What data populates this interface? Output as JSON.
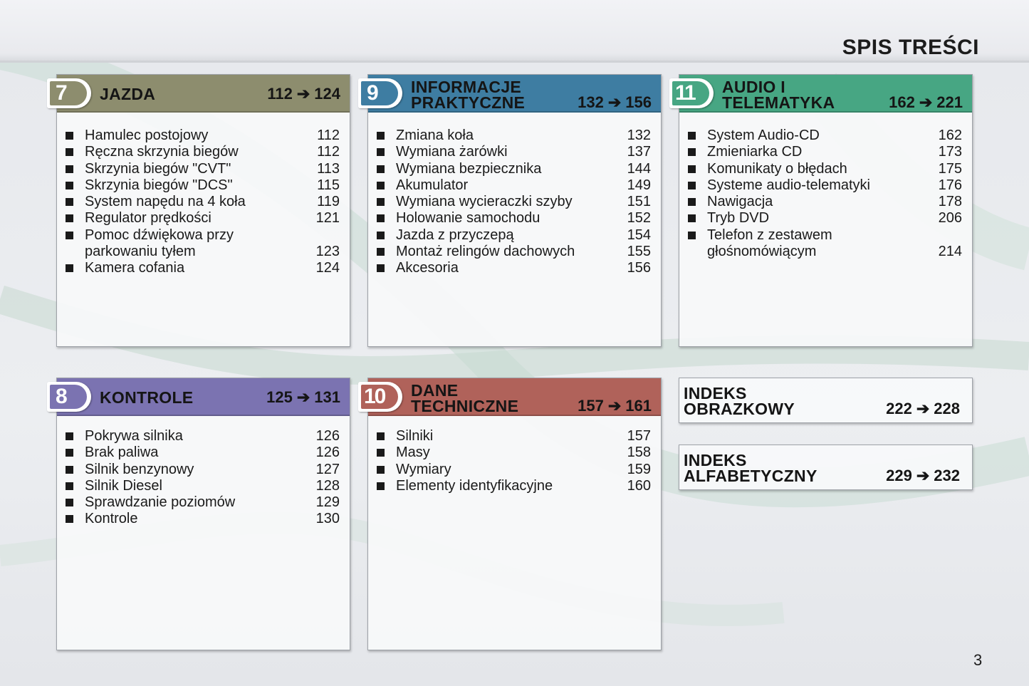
{
  "page": {
    "title": "SPIS TREŚCI",
    "number": "3"
  },
  "sections": {
    "s7": {
      "number": "7",
      "color": "#8d8d6e",
      "title": [
        "JAZDA"
      ],
      "range_from": "112",
      "arrow": "➔",
      "range_to": "124",
      "items": [
        {
          "label": "Hamulec postojowy",
          "page": "112"
        },
        {
          "label": "Ręczna skrzynia biegów",
          "page": "112"
        },
        {
          "label": "Skrzynia biegów \"CVT\"",
          "page": "113"
        },
        {
          "label": "Skrzynia biegów \"DCS\"",
          "page": "115"
        },
        {
          "label": "System napędu na 4 koła",
          "page": "119"
        },
        {
          "label": "Regulator prędkości",
          "page": "121"
        },
        {
          "label": "Pomoc dźwiękowa przy",
          "label2": "parkowaniu tyłem",
          "page": "123"
        },
        {
          "label": "Kamera cofania",
          "page": "124"
        }
      ]
    },
    "s9": {
      "number": "9",
      "color": "#3e7da2",
      "title": [
        "INFORMACJE",
        "PRAKTYCZNE"
      ],
      "range_from": "132",
      "arrow": "➔",
      "range_to": "156",
      "items": [
        {
          "label": "Zmiana koła",
          "page": "132"
        },
        {
          "label": "Wymiana żarówki",
          "page": "137"
        },
        {
          "label": "Wymiana bezpiecznika",
          "page": "144"
        },
        {
          "label": "Akumulator",
          "page": "149"
        },
        {
          "label": "Wymiana wycieraczki szyby",
          "page": "151"
        },
        {
          "label": "Holowanie samochodu",
          "page": "152"
        },
        {
          "label": "Jazda z przyczepą",
          "page": "154"
        },
        {
          "label": "Montaż relingów dachowych",
          "page": "155"
        },
        {
          "label": "Akcesoria",
          "page": "156"
        }
      ]
    },
    "s11": {
      "number": "11",
      "color": "#47a683",
      "title": [
        "AUDIO I",
        "TELEMATYKA"
      ],
      "range_from": "162",
      "arrow": "➔",
      "range_to": "221",
      "items": [
        {
          "label": "System Audio-CD",
          "page": "162"
        },
        {
          "label": "Zmieniarka CD",
          "page": "173"
        },
        {
          "label": "Komunikaty o błędach",
          "page": "175"
        },
        {
          "label": "Systeme audio-telematyki",
          "page": "176"
        },
        {
          "label": "Nawigacja",
          "page": "178"
        },
        {
          "label": "Tryb DVD",
          "page": "206"
        },
        {
          "label": "Telefon z zestawem",
          "label2": "głośnomówiącym",
          "page": "214"
        }
      ]
    },
    "s8": {
      "number": "8",
      "color": "#7b73b1",
      "title": [
        "KONTROLE"
      ],
      "range_from": "125",
      "arrow": "➔",
      "range_to": "131",
      "items": [
        {
          "label": "Pokrywa silnika",
          "page": "126"
        },
        {
          "label": "Brak paliwa",
          "page": "126"
        },
        {
          "label": "Silnik benzynowy",
          "page": "127"
        },
        {
          "label": "Silnik Diesel",
          "page": "128"
        },
        {
          "label": "Sprawdzanie poziomów",
          "page": "129"
        },
        {
          "label": "Kontrole",
          "page": "130"
        }
      ]
    },
    "s10": {
      "number": "10",
      "color": "#b0625a",
      "title": [
        "DANE",
        "TECHNICZNE"
      ],
      "range_from": "157",
      "arrow": "➔",
      "range_to": "161",
      "items": [
        {
          "label": "Silniki",
          "page": "157"
        },
        {
          "label": "Masy",
          "page": "158"
        },
        {
          "label": "Wymiary",
          "page": "159"
        },
        {
          "label": "Elementy identyfikacyjne",
          "page": "160"
        }
      ]
    }
  },
  "indexes": {
    "obrazkowy": {
      "title": [
        "INDEKS",
        "OBRAZKOWY"
      ],
      "range_from": "222",
      "arrow": "➔",
      "range_to": "228"
    },
    "alfabetyczny": {
      "title": [
        "INDEKS",
        "ALFABETYCZNY"
      ],
      "range_from": "229",
      "arrow": "➔",
      "range_to": "232"
    }
  },
  "icons": {
    "bullet": "square-bullet-icon",
    "arrow": "arrow-right-icon"
  }
}
